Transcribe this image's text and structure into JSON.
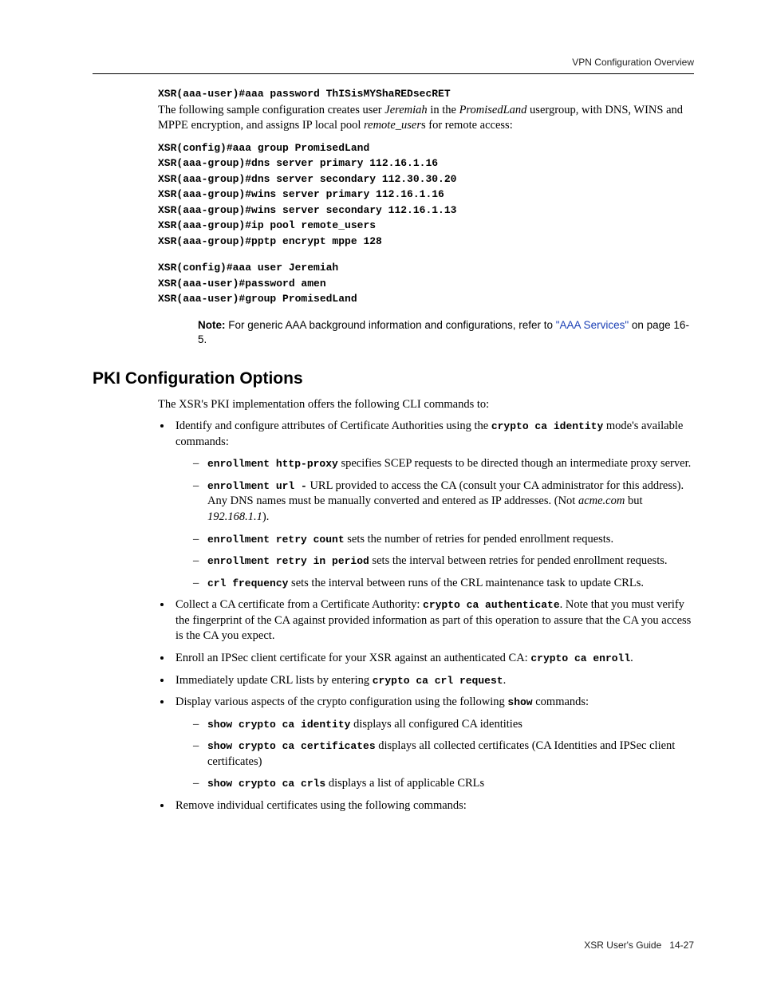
{
  "header": {
    "title": "VPN Configuration Overview"
  },
  "topcode": {
    "line1": "XSR(aaa-user)#aaa password ThISisMYShaREDsecRET"
  },
  "intro": {
    "t1": "The following sample configuration creates user ",
    "i1": "Jeremiah",
    "t2": " in the ",
    "i2": "PromisedLand",
    "t3": " usergroup, with DNS, WINS and MPPE encryption, and assigns IP local pool ",
    "i3": "remote_user",
    "t4": "s for remote access:"
  },
  "block1": {
    "l1": "XSR(config)#aaa group PromisedLand",
    "l2": "XSR(aaa-group)#dns server primary 112.16.1.16",
    "l3": "XSR(aaa-group)#dns server secondary 112.30.30.20",
    "l4": "XSR(aaa-group)#wins server primary 112.16.1.16",
    "l5": "XSR(aaa-group)#wins server secondary 112.16.1.13",
    "l6": "XSR(aaa-group)#ip pool remote_users",
    "l7": "XSR(aaa-group)#pptp encrypt mppe 128"
  },
  "block2": {
    "l1": "XSR(config)#aaa user Jeremiah",
    "l2": "XSR(aaa-user)#password amen",
    "l3": "XSR(aaa-user)#group PromisedLand"
  },
  "note": {
    "label": "Note:",
    "t1": " For generic AAA background information and configurations, refer to ",
    "link": "\"AAA Services\"",
    "t2": " on page 16-5."
  },
  "section": {
    "heading": "PKI Configuration Options"
  },
  "lead": "The XSR's PKI implementation offers the following CLI commands to:",
  "b1": {
    "pre": "Identify and configure attributes of Certificate Authorities using the ",
    "cmd": "crypto ca identity",
    "post": " mode's available commands:"
  },
  "b1s1": {
    "cmd": "enrollment http-proxy",
    "txt": " specifies SCEP requests to be directed though an intermediate proxy server."
  },
  "b1s2": {
    "cmd": "enrollment url -",
    "t1": " URL provided to access the CA (consult your CA administrator for this address). Any DNS names must be manually converted and entered as IP addresses. (Not ",
    "i1": "acme.com",
    "t2": " but ",
    "i2": "192.168.1.1",
    "t3": ")."
  },
  "b1s3": {
    "cmd": "enrollment retry count",
    "txt": " sets the number of retries for pended enrollment requests."
  },
  "b1s4": {
    "cmd": "enrollment retry in period",
    "txt": " sets the interval between retries for pended enrollment requests."
  },
  "b1s5": {
    "cmd": "crl frequency",
    "txt": " sets the interval between runs of the CRL maintenance task to update CRLs."
  },
  "b2": {
    "pre": "Collect a CA certificate from a Certificate Authority: ",
    "cmd": "crypto ca authenticate",
    "post": ". Note that you must verify the fingerprint of the CA against provided information as part of this operation to assure that the CA you access is the CA you expect."
  },
  "b3": {
    "pre": "Enroll an IPSec client certificate for your XSR against an authenticated CA: ",
    "cmd": "crypto ca enroll",
    "post": "."
  },
  "b4": {
    "pre": "Immediately update CRL lists by entering ",
    "cmd": "crypto ca crl request",
    "post": "."
  },
  "b5": {
    "pre": "Display various aspects of the crypto configuration using the following ",
    "cmd": "show",
    "post": " commands:"
  },
  "b5s1": {
    "cmd": "show crypto ca identity",
    "txt": " displays all configured CA identities"
  },
  "b5s2": {
    "cmd": "show crypto ca certificates",
    "txt": " displays all collected certificates (CA Identities and IPSec client certificates)"
  },
  "b5s3": {
    "cmd": "show crypto ca crls",
    "txt": " displays a list of applicable CRLs"
  },
  "b6": {
    "txt": "Remove individual certificates using the following commands:"
  },
  "footer": {
    "left": "XSR User's Guide",
    "right": "14-27"
  }
}
